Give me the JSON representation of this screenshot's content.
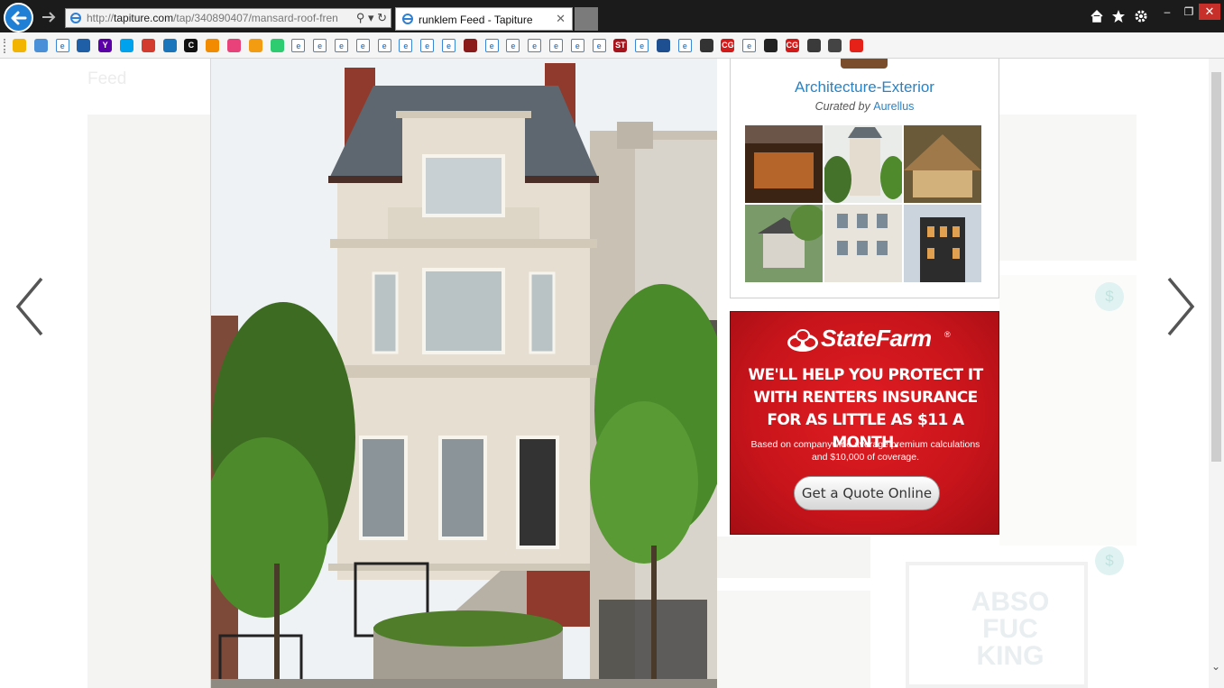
{
  "browser": {
    "url_prefix": "http://",
    "url_domain": "tapiture.com",
    "url_path": "/tap/340890407/mansard-roof-fren",
    "tab_title": "runklem Feed - Tapiture",
    "tab_close": "✕",
    "tools_text": "⚲ ▾ ↻",
    "home_icon": "home-icon",
    "favorites_icon": "star-icon",
    "settings_icon": "gear-icon",
    "minimize": "–",
    "restore": "❐",
    "close": "✕"
  },
  "favorites": [
    {
      "label": "",
      "color": "#f2b400"
    },
    {
      "label": "",
      "color": "#4a90d9"
    },
    {
      "label": "e",
      "color": "#3a87d8"
    },
    {
      "label": "",
      "color": "#1f5fa8"
    },
    {
      "label": "Y",
      "color": "#5b00a8"
    },
    {
      "label": "",
      "color": "#00a2ed"
    },
    {
      "label": "",
      "color": "#d23b2d"
    },
    {
      "label": "",
      "color": "#1b75bb"
    },
    {
      "label": "C",
      "color": "#111111"
    },
    {
      "label": "",
      "color": "#f28b00"
    },
    {
      "label": "",
      "color": "#e9427a"
    },
    {
      "label": "",
      "color": "#f39c12"
    },
    {
      "label": "",
      "color": "#2ecc71"
    },
    {
      "label": "e",
      "color": "#3a87d8"
    },
    {
      "label": "e",
      "color": "#3a87d8"
    },
    {
      "label": "e",
      "color": "#3a87d8"
    },
    {
      "label": "e",
      "color": "#3a87d8"
    },
    {
      "label": "e",
      "color": "#3a87d8"
    },
    {
      "label": "e",
      "color": "#3a87d8"
    },
    {
      "label": "e",
      "color": "#3a87d8"
    },
    {
      "label": "e",
      "color": "#3a87d8"
    },
    {
      "label": "",
      "color": "#8b1a1a"
    },
    {
      "label": "e",
      "color": "#3a87d8"
    },
    {
      "label": "e",
      "color": "#3a87d8"
    },
    {
      "label": "e",
      "color": "#3a87d8"
    },
    {
      "label": "e",
      "color": "#3a87d8"
    },
    {
      "label": "e",
      "color": "#3a87d8"
    },
    {
      "label": "e",
      "color": "#3a87d8"
    },
    {
      "label": "ST",
      "color": "#a8141b"
    },
    {
      "label": "e",
      "color": "#3a87d8"
    },
    {
      "label": "",
      "color": "#1d4f91"
    },
    {
      "label": "e",
      "color": "#3a87d8"
    },
    {
      "label": "",
      "color": "#333333"
    },
    {
      "label": "CG",
      "color": "#d11a1a"
    },
    {
      "label": "e",
      "color": "#3a87d8"
    },
    {
      "label": "",
      "color": "#222222"
    },
    {
      "label": "CG",
      "color": "#d11a1a"
    },
    {
      "label": "",
      "color": "#3a3a3a"
    },
    {
      "label": "",
      "color": "#444444"
    },
    {
      "label": "",
      "color": "#e62117"
    }
  ],
  "page": {
    "background_heading": "Feed",
    "ghost_text": "ABSO\nFUC\nKING",
    "badge": "$"
  },
  "collection": {
    "title": "Architecture-Exterior",
    "curated_prefix": "Curated by",
    "curator": "Aurellus"
  },
  "ad": {
    "brand": "StateFarm",
    "registered": "®",
    "headline": "WE'LL HELP YOU PROTECT IT WITH RENTERS INSURANCE FOR AS LITTLE AS $11 A MONTH.",
    "fine_print": "Based on companywide average premium calculations and $10,000 of coverage.",
    "cta": "Get a Quote Online",
    "color": "#d2171d"
  },
  "navigation": {
    "prev_icon": "chevron-left-icon",
    "next_icon": "chevron-right-icon"
  }
}
